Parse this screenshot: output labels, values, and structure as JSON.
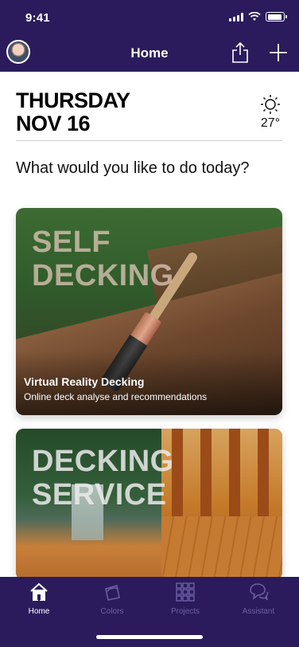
{
  "status_bar": {
    "time": "9:41"
  },
  "header": {
    "title": "Home"
  },
  "date": {
    "day": "THURSDAY",
    "date": "NOV 16"
  },
  "weather": {
    "icon": "sun-icon",
    "temperature": "27°"
  },
  "prompt": "What would you like to do today?",
  "cards": [
    {
      "overlay_line1": "SELF",
      "overlay_line2": "DECKING",
      "title": "Virtual Reality Decking",
      "description": "Online deck analyse and recommendations"
    },
    {
      "overlay_line1": "DECKING",
      "overlay_line2": "SERVICE"
    }
  ],
  "tabs": [
    {
      "label": "Home",
      "icon": "home-icon",
      "active": true
    },
    {
      "label": "Colors",
      "icon": "paint-bucket-icon",
      "active": false
    },
    {
      "label": "Projects",
      "icon": "grid-icon",
      "active": false
    },
    {
      "label": "Assistant",
      "icon": "chat-bubbles-icon",
      "active": false
    }
  ],
  "colors": {
    "header_bg": "#2b1b5c",
    "tab_inactive": "#6d60a5",
    "tab_active": "#ffffff"
  }
}
